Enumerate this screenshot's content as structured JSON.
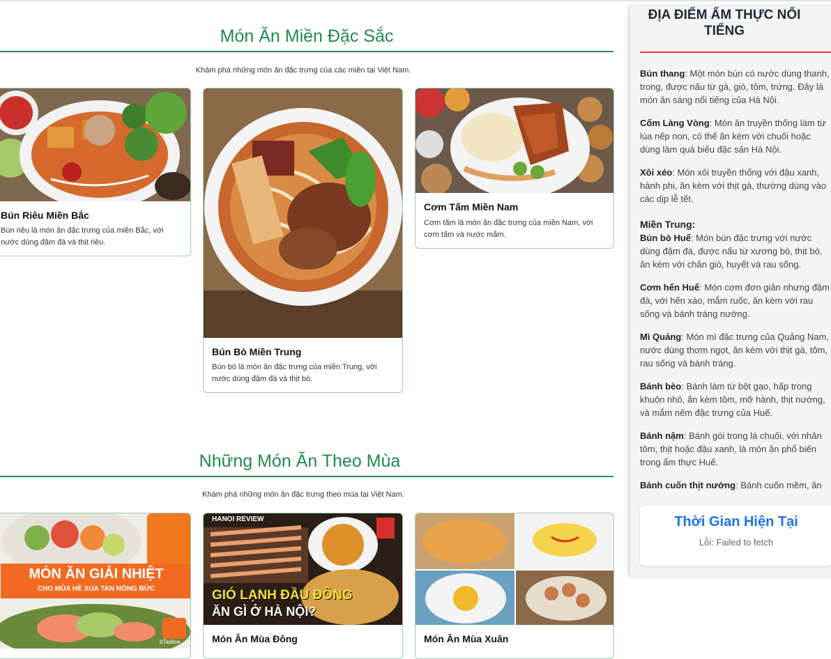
{
  "regional": {
    "title": "Món Ăn Miền Đặc Sắc",
    "subtitle": "Khám phá những món ăn đặc trưng của các miền tại Việt Nam.",
    "cards": [
      {
        "title": "Bún Riêu Miền Bắc",
        "desc": "Bún riêu là món ăn đặc trưng của miền Bắc, với nước dùng đậm đà và thịt riêu."
      },
      {
        "title": "Bún Bò Miền Trung",
        "desc": "Bún bò là món ăn đặc trưng của miền Trung, với nước dùng đậm đà và thịt bò."
      },
      {
        "title": "Cơm Tấm Miền Nam",
        "desc": "Cơm tấm là món ăn đặc trưng của miền Nam, với cơm tấm và nước mắm."
      }
    ]
  },
  "seasonal": {
    "title": "Những Món Ăn Theo Mùa",
    "subtitle": "Khám phá những món ăn đặc trưng theo mùa tại Việt Nam.",
    "cards": [
      {
        "title": "",
        "image_text_1": "MÓN ĂN GIẢI NHIỆT",
        "image_text_2": "CHO MÙA HÈ XUA TAN NÓNG BỨC",
        "image_logo": "bTaskee"
      },
      {
        "title": "Món Ăn Mùa Đông",
        "image_text_1": "GIÓ LẠNH ĐẦU ĐÔNG",
        "image_text_2": "ĂN GÌ Ở HÀ NỘI?",
        "image_logo": "HANOI REVIEW"
      },
      {
        "title": "Món Ăn Mùa Xuân"
      }
    ]
  },
  "sidebar": {
    "title": "ĐỊA ĐIỂM ẨM THỰC NỔI TIẾNG",
    "items_north": [
      {
        "name": "Bún thang",
        "text": ": Một món bún có nước dùng thanh, trong, được nấu từ gà, giò, tôm, trứng. Đây là món ăn sáng nổi tiếng của Hà Nội."
      },
      {
        "name": "Cốm Làng Vòng",
        "text": ": Món ăn truyền thống làm từ lúa nếp non, có thể ăn kèm với chuối hoặc dùng làm quà biếu đặc sản Hà Nội."
      },
      {
        "name": "Xôi xéo",
        "text": ": Món xôi truyền thống với đậu xanh, hành phi, ăn kèm với thịt gà, thường dùng vào các dịp lễ tết."
      }
    ],
    "region_central": "Miền Trung:",
    "items_central": [
      {
        "name": "Bún bò Huế",
        "text": ": Món bún đặc trưng với nước dùng đậm đà, được nấu từ xương bò, thịt bò, ăn kèm với chân giò, huyết và rau sống."
      },
      {
        "name": "Cơm hến Huế",
        "text": ": Món cơm đơn giản nhưng đậm đà, với hến xào, mắm ruốc, ăn kèm với rau sống và bánh tráng nướng."
      },
      {
        "name": "Mì Quảng",
        "text": ": Món mì đặc trưng của Quảng Nam, nước dùng thơm ngọt, ăn kèm với thịt gà, tôm, rau sống và bánh tráng."
      },
      {
        "name": "Bánh bèo",
        "text": ": Bánh làm từ bột gạo, hấp trong khuôn nhỏ, ăn kèm tôm, mỡ hành, thịt nướng, và mắm nêm đặc trưng của Huế."
      },
      {
        "name": "Bánh nậm",
        "text": ": Bánh gói trong lá chuối, với nhân tôm, thịt hoặc đậu xanh, là món ăn phổ biến trong ẩm thực Huế."
      },
      {
        "name": "Bánh cuốn thịt nướng",
        "text": ": Bánh cuốn mềm, ăn kèm"
      }
    ]
  },
  "clock": {
    "title": "Thời Gian Hiện Tại",
    "error": "Lỗi: Failed to fetch"
  },
  "colors": {
    "accent_green": "#1f8a4c",
    "sidebar_red": "#e53935",
    "clock_blue": "#1a73e8"
  }
}
